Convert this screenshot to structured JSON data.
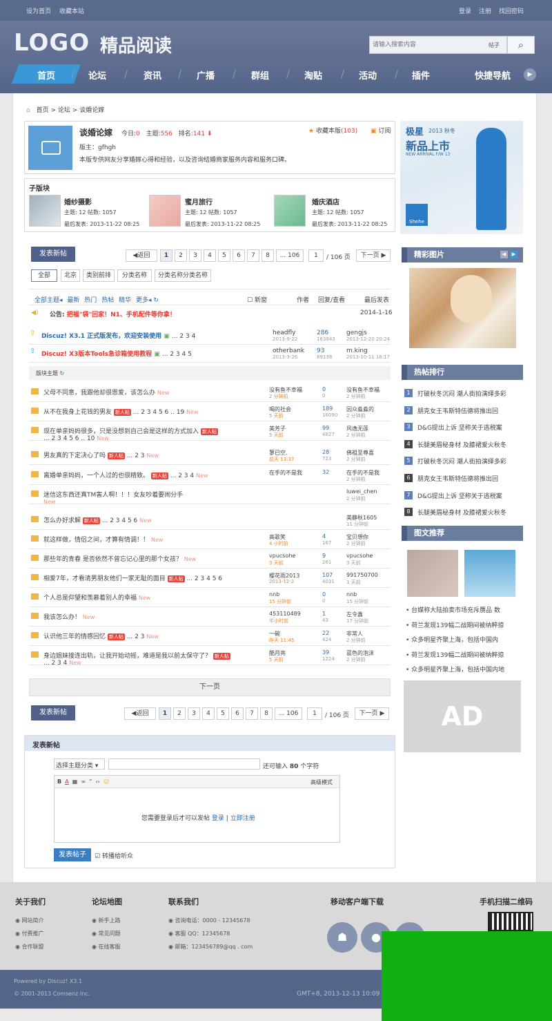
{
  "topbar": {
    "set_home": "设为首页",
    "favorite": "收藏本站",
    "login": "登录",
    "register": "注册",
    "find_pw": "找回密码"
  },
  "header": {
    "logo": "LOGO",
    "subtitle": "精品阅读",
    "search_placeholder": "请输入搜索内容",
    "search_type": "帖子"
  },
  "nav": [
    "首页",
    "论坛",
    "资讯",
    "广播",
    "群组",
    "淘贴",
    "活动",
    "插件"
  ],
  "nav_quick": "快捷导航",
  "breadcrumb": {
    "home": "首页",
    "sep1": ">",
    "forum": "论坛",
    "sep2": ">",
    "current": "谈婚论嫁"
  },
  "forum": {
    "name": "谈婚论嫁",
    "today_label": "今日:",
    "today": "0",
    "topics_label": "主题:",
    "topics": "556",
    "rank_label": "排名:",
    "rank": "141",
    "mod": "版主：gfhgh",
    "desc": "本版专供网友分享婚嫁心得和经验，以及咨询结婚商家服务内容和服务口碑。",
    "fav": "收藏本版",
    "fav_count": "(103)",
    "subscribe": "订阅"
  },
  "subforums": {
    "title": "子版块",
    "items": [
      {
        "name": "婚纱摄影",
        "stats": "主题: 12  帖数: 1057",
        "last": "最后发表: 2013-11-22 08:25"
      },
      {
        "name": "蜜月旅行",
        "stats": "主题: 12  帖数: 1057",
        "last": "最后发表: 2013-11-22 08:25"
      },
      {
        "name": "婚庆酒店",
        "stats": "主题: 12  帖数: 1057",
        "last": "最后发表: 2013-11-22 08:25"
      }
    ]
  },
  "pager": {
    "post": "发表新帖",
    "back": "◀返回",
    "pages": [
      "1",
      "2",
      "3",
      "4",
      "5",
      "6",
      "7",
      "8",
      "... 106"
    ],
    "input": "1",
    "total": "/ 106 页",
    "next": "下一页 ▶"
  },
  "tabs": [
    "全部",
    "北京",
    "类别前排",
    "分类名称",
    "分类名称分类名称"
  ],
  "list_head": {
    "all": "全部主题",
    "latest": "最新",
    "hot": "热门",
    "heat": "热帖",
    "digest": "精华",
    "more": "更多",
    "new": "新窗",
    "author": "作者",
    "reply": "回复/查看",
    "last": "最后发表"
  },
  "notice": {
    "label": "公告:",
    "text": "把福\"袋\"回家！N1、手机配件等你拿！",
    "date": "2014-1-16"
  },
  "sticky": [
    {
      "title": "Discuz! X3.1 正式版发布，欢迎安装使用",
      "pages": "... 2 3 4",
      "author": "headfly",
      "adate": "2013-9-22",
      "reply": "286",
      "view": "163843",
      "last": "gengjs",
      "ldate": "2013-12-20 20:24"
    },
    {
      "title": "Discuz! X3版本Tools急诊箱使用教程",
      "pages": "... 2 3 4 5",
      "author": "otherbank",
      "adate": "2013-3-26",
      "reply": "93",
      "view": "89138",
      "last": "m.king",
      "ldate": "2013-10-11 16:17"
    }
  ],
  "section_label": "版块主题",
  "threads": [
    {
      "title": "父母不同意，我跟他却很恩爱，该怎么办",
      "tag": "New",
      "author": "没有鱼不幸福",
      "adate": "2 分钟前",
      "reply": "0",
      "view": "0",
      "last": "没有鱼不幸福",
      "ldate": "2 分钟前"
    },
    {
      "title": "从不在我身上花钱的男友",
      "badge": "新人帖",
      "pages": "... 2 3 4 5 6 .. 19",
      "tag": "New",
      "author": "喝的社会",
      "adate": "5 天前",
      "reply": "189",
      "view": "16090",
      "last": "因众淼淼的",
      "ldate": "2 分钟前"
    },
    {
      "title": "现在单亲妈妈很多，只是没想到自己会是这样的方式加入",
      "badge": "新人帖",
      "pages": "... 2 3 4 5 6 .. 10",
      "tag": "New",
      "author": "美芳子",
      "adate": "5 天前",
      "reply": "99",
      "view": "4827",
      "last": "风逸无莲",
      "ldate": "2 分钟前"
    },
    {
      "title": "男友真的下定决心了吗",
      "badge": "新人帖",
      "pages": "... 2 3",
      "tag": "New",
      "author": "蓼已空.",
      "adate": "前天 13:37",
      "reply": "28",
      "view": "723",
      "last": "佛祖至尊喜",
      "ldate": "2 分钟前"
    },
    {
      "title": "离婚单亲妈妈，一个人过的也很精致。",
      "badge": "新人帖",
      "pages": "... 2 3 4",
      "tag": "New",
      "author": "在手的不是我",
      "adate": "",
      "reply": "32",
      "view": "",
      "last": "在手的不是我",
      "ldate": "2 分钟前"
    },
    {
      "title": "迷信这东西还真TM害人啊！！！女友吵着要闹分手",
      "tag": "New",
      "author": "",
      "adate": "",
      "reply": "",
      "view": "",
      "last": "luwei_chen",
      "ldate": "2 分钟前"
    },
    {
      "title": "怎么办好求解",
      "badge": "新人帖",
      "pages": "... 2 3 4 5 6",
      "tag": "New",
      "author": "",
      "adate": "",
      "reply": "",
      "view": "",
      "last": "美静秋1605",
      "ldate": "11 分钟前"
    },
    {
      "title": "就这样做，情侣之间，才算有情调！！",
      "tag": "New",
      "author": "高歌笑",
      "adate": "4 小时前",
      "reply": "4",
      "view": "167",
      "last": "宝贝想你",
      "ldate": "2 分钟前"
    },
    {
      "title": "那些年的青春 是否依然不曾忘记心里的那个女孩？",
      "tag": "New",
      "author": "vpucsohe",
      "adate": "3 天前",
      "reply": "9",
      "view": "261",
      "last": "vpucsohe",
      "ldate": "3 天前"
    },
    {
      "title": "相爱7年，才看清男朋友他们一家无耻的面目",
      "badge": "新人帖",
      "pages": "... 2 3 4 5 6",
      "tag": "",
      "author": "樱花雨2013",
      "adate": "2013-12-2",
      "reply": "107",
      "view": "4031",
      "last": "991750700",
      "ldate": "1 天前"
    },
    {
      "title": "个人总是仰望和羡慕着别人的幸福",
      "tag": "New",
      "author": "nnb",
      "adate": "15 分钟前",
      "reply": "0",
      "view": "0",
      "last": "nnb",
      "ldate": "15 分钟前"
    },
    {
      "title": "我该怎么办！",
      "tag": "New",
      "author": "453110489",
      "adate": "半小时前",
      "reply": "1",
      "view": "43",
      "last": "左令鑫",
      "ldate": "17 分钟前"
    },
    {
      "title": "认识他三年的情感回忆",
      "badge": "新人帖",
      "pages": "... 2 3",
      "tag": "New",
      "author": "一碗",
      "adate": "昨天 11:45",
      "reply": "22",
      "view": "424",
      "last": "非常人",
      "ldate": "2 分钟前"
    },
    {
      "title": "身边姐妹接连出轨，让我开始动摇，难道是我以前太保守了？",
      "badge": "新人帖",
      "pages": "... 2 3 4",
      "tag": "New",
      "author": "酷月亮",
      "adate": "5 天前",
      "reply": "39",
      "view": "1224",
      "last": "蓝色的泡沫",
      "ldate": "2 分钟前"
    }
  ],
  "next_page": "下一页",
  "quick_post": {
    "title": "发表新帖",
    "category": "选择主题分类",
    "limit_prefix": "还可输入",
    "limit": "80",
    "limit_suffix": "个字符",
    "advanced": "高级模式",
    "login_tip": "您需要登录后才可以发帖",
    "login": "登录",
    "sep": "|",
    "register": "立即注册",
    "submit": "发表帖子",
    "forward": "转播给听众"
  },
  "sidebar": {
    "banner_title": "极星",
    "banner_sub": "2013 秋冬",
    "banner_main": "新品上市",
    "banner_en": "NEW ARRIVAL F/W 13",
    "pics_title": "精彩图片",
    "hot_title": "热帖排行",
    "hot": [
      "打破秋冬沉闷 潮人街拍演绎多彩",
      "朋克女王韦斯特伍德将推出回",
      "D&G提出上诉 坚称关于逃税案",
      "长腿美眉秘身材 及膝裙爱火秋冬",
      "打破秋冬沉闷 潮人街拍演绎多彩",
      "朋克女王韦斯特伍德将推出回",
      "D&G提出上诉 坚称关于逃税案",
      "长腿美眉秘身材 及膝裙爱火秋冬"
    ],
    "img_title": "图文推荐",
    "news": [
      "台媒称大陆拍卖市场充斥赝品 数",
      "荷兰发现139幅二战期间被纳粹掠",
      "众多明星齐聚上海，包括中国内",
      "荷兰发现139幅二战期间被纳粹掠",
      "众多明星齐聚上海，包括中国内地"
    ],
    "ad": "AD"
  },
  "footer": {
    "about": "关于我们",
    "about_items": [
      "网站简介",
      "付费推广",
      "合作联盟"
    ],
    "map": "论坛地图",
    "map_items": [
      "新手上路",
      "常见问题",
      "在线客服"
    ],
    "contact": "联系我们",
    "contact_items": [
      "咨询电话：0000 - 12345678",
      "客服 QQ：12345678",
      "邮箱：123456789@qq . com"
    ],
    "mobile": "移动客户端下载",
    "qr": "手机扫描二维码",
    "powered": "Powered by Discuz! X3.1",
    "copy": "© 2001-2013 Comsenz Inc.",
    "gmt": "GMT+8, 2013-12-13 10:09"
  },
  "colors": {
    "accent": "#3a98d8",
    "header": "#5a6a8c",
    "sidebar_head": "#6a7d9f"
  }
}
